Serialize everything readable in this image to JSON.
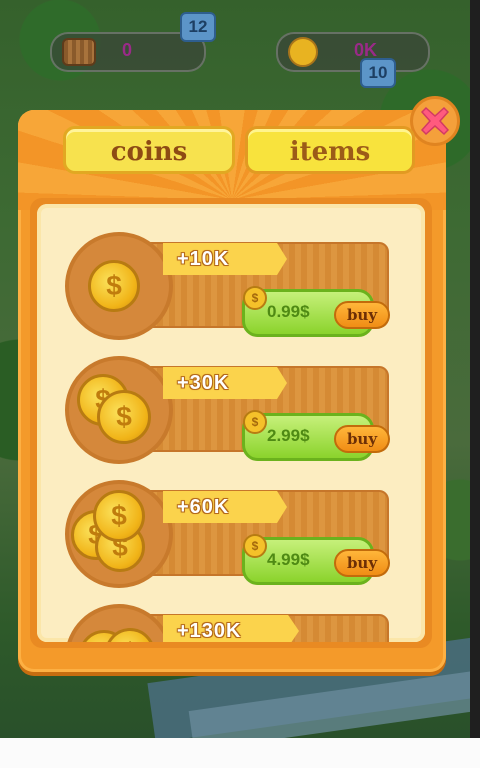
{
  "hud": {
    "basket_value": "0",
    "coins_value": "0K",
    "tile_left": "12",
    "tile_right": "10",
    "basket_icon": "basket-icon",
    "coin_icon": "coin-icon"
  },
  "tabs": [
    {
      "label": "coins",
      "active": true
    },
    {
      "label": "items",
      "active": false
    }
  ],
  "offers": [
    {
      "amount": "+10K",
      "price": "0.99$",
      "buy_label": "buy",
      "coin_count": 1
    },
    {
      "amount": "+30K",
      "price": "2.99$",
      "buy_label": "buy",
      "coin_count": 2
    },
    {
      "amount": "+60K",
      "price": "4.99$",
      "buy_label": "buy",
      "coin_count": 3
    },
    {
      "amount": "+130K",
      "price": "",
      "buy_label": "",
      "coin_count": 4
    }
  ],
  "colors": {
    "panel": "#f49a2a",
    "tab_active": "#f7e24e",
    "price_button": "#8bd32c",
    "buy_button": "#f08d15",
    "close_button": "#ff5a7e"
  },
  "icons": {
    "close": "close-x-icon",
    "dollar": "dollar-coin-icon"
  }
}
